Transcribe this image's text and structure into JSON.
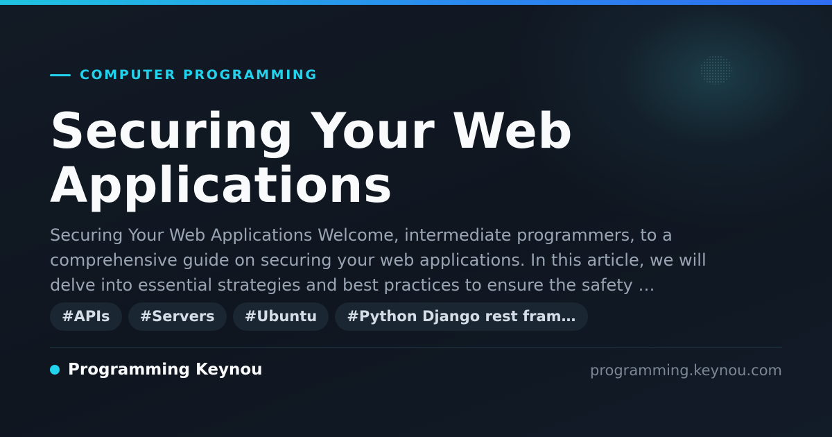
{
  "colors": {
    "accent": "#22d3ee",
    "background": "#111722",
    "title": "#f8fafc",
    "excerpt": "#9aa5b4",
    "tag_background": "#1b2633",
    "tag_text": "#d5dde6",
    "domain_text": "#7c8796"
  },
  "header": {
    "category": "COMPUTER PROGRAMMING"
  },
  "article": {
    "title": "Securing Your Web Applications",
    "excerpt": "Securing Your Web Applications Welcome, intermediate programmers, to a comprehensive guide on securing your web applications. In this article, we will delve into essential strategies and best practices to ensure the safety …"
  },
  "tags": [
    "#APIs",
    "#Servers",
    "#Ubuntu",
    "#Python Django rest fram…"
  ],
  "footer": {
    "brand_name": "Programming Keynou",
    "domain": "programming.keynou.com",
    "brand_icon": "dot-icon"
  }
}
